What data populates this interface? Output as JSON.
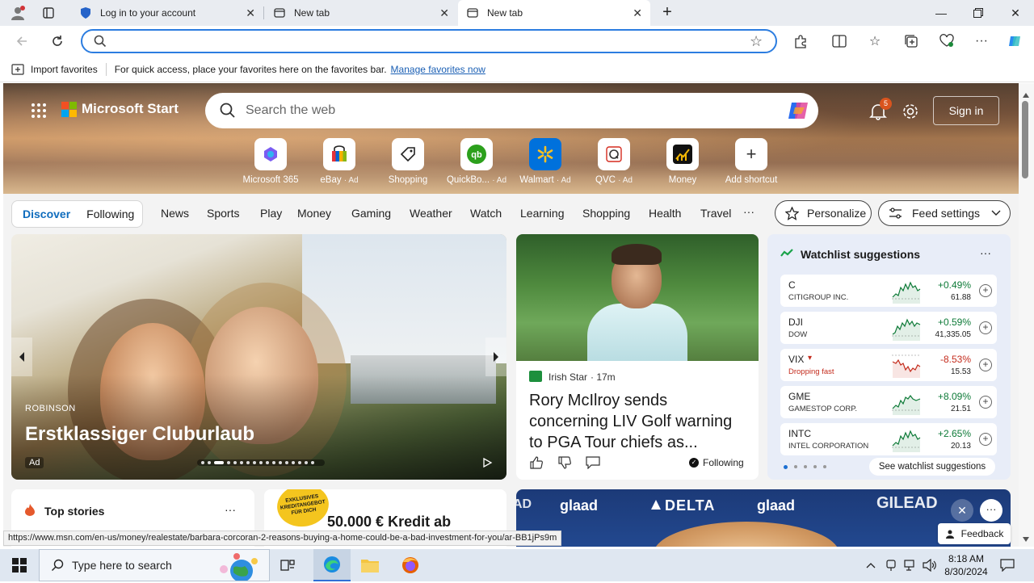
{
  "tabs": [
    {
      "title": "Log in to your account",
      "active": false
    },
    {
      "title": "New tab",
      "active": false
    },
    {
      "title": "New tab",
      "active": true
    }
  ],
  "address_bar": {
    "value": ""
  },
  "favorites_bar": {
    "import_label": "Import favorites",
    "hint": "For quick access, place your favorites here on the favorites bar.",
    "manage_link": "Manage favorites now"
  },
  "msstart": {
    "brand": "Microsoft Start",
    "search_placeholder": "Search the web",
    "notification_count": "5",
    "sign_in": "Sign in",
    "shortcuts": [
      {
        "label": "Microsoft 365",
        "ad": "",
        "icon": "m365-icon"
      },
      {
        "label": "eBay",
        "ad": "· Ad",
        "icon": "ebay-icon"
      },
      {
        "label": "Shopping",
        "ad": "",
        "icon": "shopping-tag-icon"
      },
      {
        "label": "QuickBo...",
        "ad": "· Ad",
        "icon": "quickbooks-icon"
      },
      {
        "label": "Walmart",
        "ad": "· Ad",
        "icon": "walmart-icon"
      },
      {
        "label": "QVC",
        "ad": "· Ad",
        "icon": "qvc-icon"
      },
      {
        "label": "Money",
        "ad": "",
        "icon": "money-chart-icon"
      },
      {
        "label": "Add shortcut",
        "ad": "",
        "icon": "plus-icon"
      }
    ]
  },
  "nav": {
    "discover": "Discover",
    "following": "Following",
    "items": [
      "News",
      "Sports",
      "Play",
      "Money",
      "Gaming",
      "Weather",
      "Watch",
      "Learning",
      "Shopping",
      "Health",
      "Travel"
    ],
    "more": "···",
    "personalize": "Personalize",
    "feed_settings": "Feed settings"
  },
  "hero_card": {
    "brand": "ROBINSON",
    "title": "Erstklassiger Cluburlaub",
    "ad": "Ad"
  },
  "news_card": {
    "source": "Irish Star",
    "time": "· 17m",
    "headline": "Rory McIlroy sends concerning LIV Golf warning to PGA Tour chiefs as...",
    "following": "Following"
  },
  "watchlist": {
    "title": "Watchlist suggestions",
    "more": "···",
    "footer_link": "See watchlist suggestions",
    "stocks": [
      {
        "symbol": "C",
        "name": "CITIGROUP INC.",
        "change": "+0.49%",
        "price": "61.88",
        "dir": "up"
      },
      {
        "symbol": "DJI",
        "name": "DOW",
        "change": "+0.59%",
        "price": "41,335.05",
        "dir": "up"
      },
      {
        "symbol": "VIX",
        "name": "Dropping fast",
        "change": "-8.53%",
        "price": "15.53",
        "dir": "down"
      },
      {
        "symbol": "GME",
        "name": "GAMESTOP CORP.",
        "change": "+8.09%",
        "price": "21.51",
        "dir": "up"
      },
      {
        "symbol": "INTC",
        "name": "INTEL CORPORATION",
        "change": "+2.65%",
        "price": "20.13",
        "dir": "up"
      }
    ],
    "colors": {
      "up": "#0d7a37",
      "down": "#c42b1c"
    }
  },
  "top_stories": {
    "title": "Top stories",
    "more": "···"
  },
  "ad_card": {
    "badge": "EXKLUSIVES KREDITANGEBOT FÜR DICH",
    "headline": "50.000 € Kredit ab"
  },
  "delta_card": {
    "glaad1": "glaad",
    "delta": "DELTA",
    "glaad2": "glaad",
    "ad_left": "AD",
    "gilead": "GILEAD"
  },
  "feedback": "Feedback",
  "status_url": "https://www.msn.com/en-us/money/realestate/barbara-corcoran-2-reasons-buying-a-home-could-be-a-bad-investment-for-you/ar-BB1jPs9m",
  "taskbar": {
    "search_placeholder": "Type here to search",
    "time": "8:18 AM",
    "date": "8/30/2024"
  }
}
